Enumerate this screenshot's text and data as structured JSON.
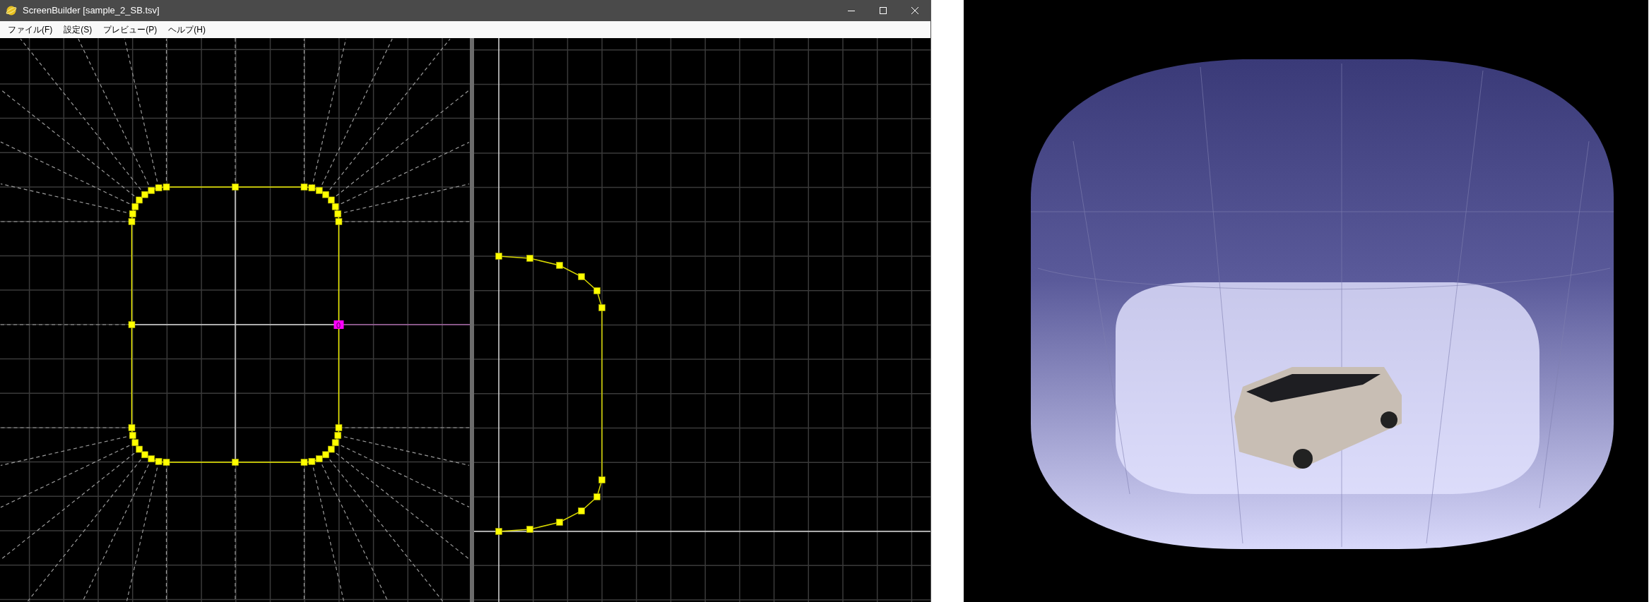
{
  "window": {
    "title": "ScreenBuilder [sample_2_SB.tsv]"
  },
  "menu": [
    {
      "label": "ファイル(F)"
    },
    {
      "label": "設定(S)"
    },
    {
      "label": "プレビュー(P)"
    },
    {
      "label": "ヘルプ(H)"
    }
  ],
  "front_view": {
    "selected_point": {
      "label": "0"
    }
  }
}
